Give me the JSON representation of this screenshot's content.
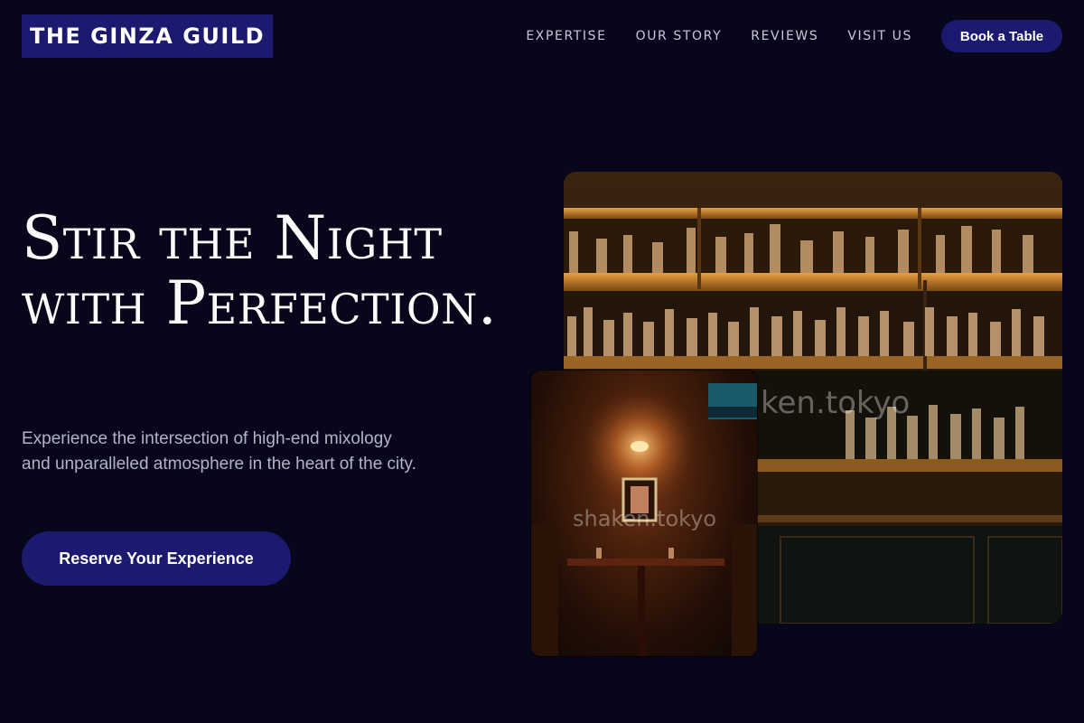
{
  "brand": {
    "name": "THE GINZA GUILD"
  },
  "nav": {
    "links": [
      "EXPERTISE",
      "OUR STORY",
      "REVIEWS",
      "VISIT US"
    ],
    "book_label": "Book a Table"
  },
  "hero": {
    "title": "Stir the Night with Perfection.",
    "subtitle": "Experience the intersection of high-end mixology and unparalleled atmosphere in the heart of the city.",
    "cta_label": "Reserve Your Experience"
  },
  "images": {
    "bar_watermark": "ken.tokyo",
    "booth_watermark": "shaken.tokyo"
  },
  "colors": {
    "background": "#07061a",
    "accent": "#1c1a6e"
  }
}
